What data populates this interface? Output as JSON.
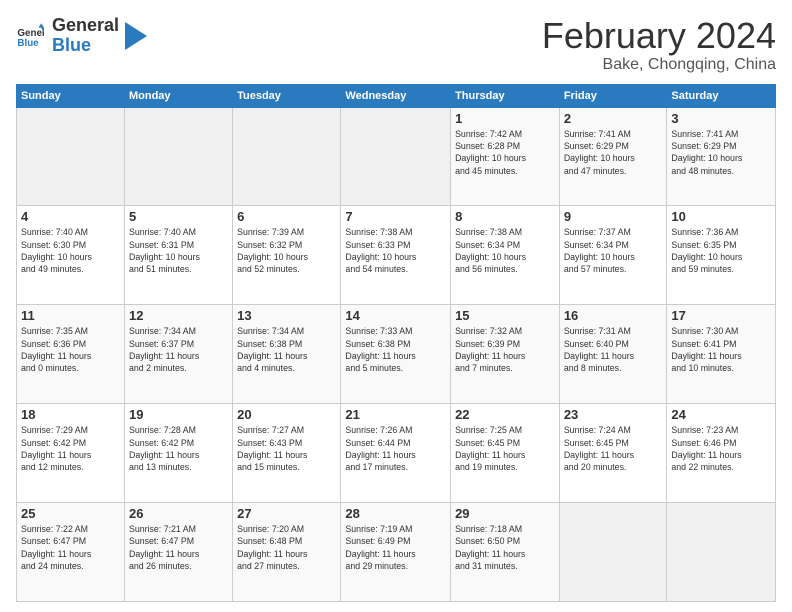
{
  "logo": {
    "general": "General",
    "blue": "Blue"
  },
  "title": "February 2024",
  "subtitle": "Bake, Chongqing, China",
  "days_header": [
    "Sunday",
    "Monday",
    "Tuesday",
    "Wednesday",
    "Thursday",
    "Friday",
    "Saturday"
  ],
  "weeks": [
    [
      {
        "day": "",
        "info": ""
      },
      {
        "day": "",
        "info": ""
      },
      {
        "day": "",
        "info": ""
      },
      {
        "day": "",
        "info": ""
      },
      {
        "day": "1",
        "info": "Sunrise: 7:42 AM\nSunset: 6:28 PM\nDaylight: 10 hours\nand 45 minutes."
      },
      {
        "day": "2",
        "info": "Sunrise: 7:41 AM\nSunset: 6:29 PM\nDaylight: 10 hours\nand 47 minutes."
      },
      {
        "day": "3",
        "info": "Sunrise: 7:41 AM\nSunset: 6:29 PM\nDaylight: 10 hours\nand 48 minutes."
      }
    ],
    [
      {
        "day": "4",
        "info": "Sunrise: 7:40 AM\nSunset: 6:30 PM\nDaylight: 10 hours\nand 49 minutes."
      },
      {
        "day": "5",
        "info": "Sunrise: 7:40 AM\nSunset: 6:31 PM\nDaylight: 10 hours\nand 51 minutes."
      },
      {
        "day": "6",
        "info": "Sunrise: 7:39 AM\nSunset: 6:32 PM\nDaylight: 10 hours\nand 52 minutes."
      },
      {
        "day": "7",
        "info": "Sunrise: 7:38 AM\nSunset: 6:33 PM\nDaylight: 10 hours\nand 54 minutes."
      },
      {
        "day": "8",
        "info": "Sunrise: 7:38 AM\nSunset: 6:34 PM\nDaylight: 10 hours\nand 56 minutes."
      },
      {
        "day": "9",
        "info": "Sunrise: 7:37 AM\nSunset: 6:34 PM\nDaylight: 10 hours\nand 57 minutes."
      },
      {
        "day": "10",
        "info": "Sunrise: 7:36 AM\nSunset: 6:35 PM\nDaylight: 10 hours\nand 59 minutes."
      }
    ],
    [
      {
        "day": "11",
        "info": "Sunrise: 7:35 AM\nSunset: 6:36 PM\nDaylight: 11 hours\nand 0 minutes."
      },
      {
        "day": "12",
        "info": "Sunrise: 7:34 AM\nSunset: 6:37 PM\nDaylight: 11 hours\nand 2 minutes."
      },
      {
        "day": "13",
        "info": "Sunrise: 7:34 AM\nSunset: 6:38 PM\nDaylight: 11 hours\nand 4 minutes."
      },
      {
        "day": "14",
        "info": "Sunrise: 7:33 AM\nSunset: 6:38 PM\nDaylight: 11 hours\nand 5 minutes."
      },
      {
        "day": "15",
        "info": "Sunrise: 7:32 AM\nSunset: 6:39 PM\nDaylight: 11 hours\nand 7 minutes."
      },
      {
        "day": "16",
        "info": "Sunrise: 7:31 AM\nSunset: 6:40 PM\nDaylight: 11 hours\nand 8 minutes."
      },
      {
        "day": "17",
        "info": "Sunrise: 7:30 AM\nSunset: 6:41 PM\nDaylight: 11 hours\nand 10 minutes."
      }
    ],
    [
      {
        "day": "18",
        "info": "Sunrise: 7:29 AM\nSunset: 6:42 PM\nDaylight: 11 hours\nand 12 minutes."
      },
      {
        "day": "19",
        "info": "Sunrise: 7:28 AM\nSunset: 6:42 PM\nDaylight: 11 hours\nand 13 minutes."
      },
      {
        "day": "20",
        "info": "Sunrise: 7:27 AM\nSunset: 6:43 PM\nDaylight: 11 hours\nand 15 minutes."
      },
      {
        "day": "21",
        "info": "Sunrise: 7:26 AM\nSunset: 6:44 PM\nDaylight: 11 hours\nand 17 minutes."
      },
      {
        "day": "22",
        "info": "Sunrise: 7:25 AM\nSunset: 6:45 PM\nDaylight: 11 hours\nand 19 minutes."
      },
      {
        "day": "23",
        "info": "Sunrise: 7:24 AM\nSunset: 6:45 PM\nDaylight: 11 hours\nand 20 minutes."
      },
      {
        "day": "24",
        "info": "Sunrise: 7:23 AM\nSunset: 6:46 PM\nDaylight: 11 hours\nand 22 minutes."
      }
    ],
    [
      {
        "day": "25",
        "info": "Sunrise: 7:22 AM\nSunset: 6:47 PM\nDaylight: 11 hours\nand 24 minutes."
      },
      {
        "day": "26",
        "info": "Sunrise: 7:21 AM\nSunset: 6:47 PM\nDaylight: 11 hours\nand 26 minutes."
      },
      {
        "day": "27",
        "info": "Sunrise: 7:20 AM\nSunset: 6:48 PM\nDaylight: 11 hours\nand 27 minutes."
      },
      {
        "day": "28",
        "info": "Sunrise: 7:19 AM\nSunset: 6:49 PM\nDaylight: 11 hours\nand 29 minutes."
      },
      {
        "day": "29",
        "info": "Sunrise: 7:18 AM\nSunset: 6:50 PM\nDaylight: 11 hours\nand 31 minutes."
      },
      {
        "day": "",
        "info": ""
      },
      {
        "day": "",
        "info": ""
      }
    ]
  ]
}
